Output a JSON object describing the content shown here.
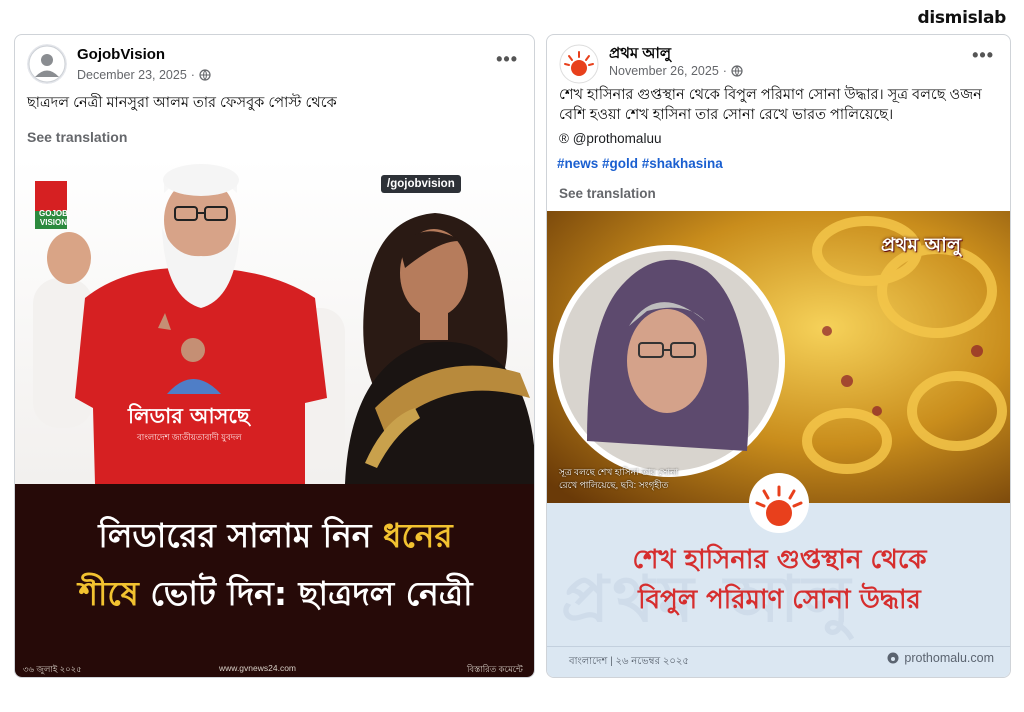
{
  "brand": {
    "name": "dismislab"
  },
  "left_post": {
    "author": "GojobVision",
    "date": "December 23, 2025",
    "more_label": "•••",
    "caption": "ছাত্রদল নেত্রী মানসুরা আলম তার ফেসবুক পোস্ট থেকে",
    "see_translation": "See translation",
    "image": {
      "logo_text": "GOJOB\nVISION",
      "handle": "/gojobvision",
      "tshirt_text": "লিডার আসছে",
      "tshirt_sub": "বাংলাদেশ জাতীয়তাবাদী যুবদল",
      "headline_line1_a": "লিডারের সালাম নিন",
      "headline_line1_b": "ধনের",
      "headline_line2_a": "শীষে",
      "headline_line2_b": "ভোট দিন: ছাত্রদল নেত্রী",
      "footer_date": "৩৬ জুলাই ২০২৫",
      "footer_site": "www.gvnews24.com",
      "footer_more": "বিস্তারিত কমেন্টে"
    }
  },
  "right_post": {
    "author": "প্রথম আলু",
    "date": "November 26, 2025",
    "more_label": "•••",
    "caption": "শেখ হাসিনার গুপ্তস্থান থেকে বিপুল পরিমাণ সোনা উদ্ধার। সূত্র বলছে ওজন বেশি হওয়া শেখ হাসিনা তার সোনা রেখে ভারত পালিয়েছে।",
    "handle": "@prothomaluu",
    "hashtags": "#news #gold #shakhasina",
    "see_translation": "See translation",
    "image": {
      "logo_text": "প্রথম আলু",
      "photo_caption": "সূত্র বলছে শেখ হাসিনা তার সোনা\nরেখে পালিয়েছে, ছবি: সংগৃহীত",
      "headline_line1": "শেখ হাসিনার গুপ্তস্থান থেকে",
      "headline_line2": "বিপুল পরিমাণ সোনা উদ্ধার",
      "watermark": "প্রথম আলু",
      "footer_left": "বাংলাদেশ | ২৬ নভেম্বর ২০২৫",
      "footer_right": "prothomalu.com"
    }
  },
  "colors": {
    "headline_bg": "#260a08",
    "headline_accent": "#f2c230",
    "news_red": "#d62e2e",
    "news_bg": "#dbe7f2",
    "hashtag_blue": "#1a5fd0"
  }
}
